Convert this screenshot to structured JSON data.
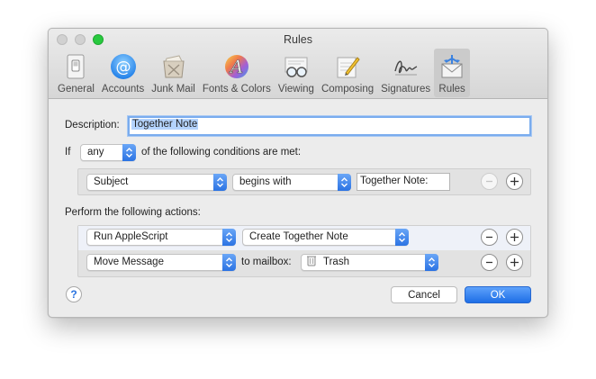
{
  "window": {
    "title": "Rules"
  },
  "toolbar": {
    "items": [
      {
        "label": "General",
        "icon": "general-switch-icon"
      },
      {
        "label": "Accounts",
        "icon": "at-sign-icon"
      },
      {
        "label": "Junk Mail",
        "icon": "junk-mail-bin-icon"
      },
      {
        "label": "Fonts & Colors",
        "icon": "fonts-colors-icon"
      },
      {
        "label": "Viewing",
        "icon": "glasses-icon"
      },
      {
        "label": "Composing",
        "icon": "pencil-paper-icon"
      },
      {
        "label": "Signatures",
        "icon": "signature-icon"
      },
      {
        "label": "Rules",
        "icon": "rules-envelope-icon",
        "selected": true
      }
    ]
  },
  "rule": {
    "description_label": "Description:",
    "description_value": "Together Note",
    "if_label": "If",
    "match_value": "any",
    "conditions_suffix": "of the following conditions are met:",
    "conditions": [
      {
        "field": "Subject",
        "operator": "begins with",
        "value": "Together Note:"
      }
    ],
    "actions_label": "Perform the following actions:",
    "actions": [
      {
        "action": "Run AppleScript",
        "target": "Create Together Note"
      },
      {
        "action": "Move Message",
        "connector": "to mailbox:",
        "target": "Trash",
        "target_icon": "trash-can-icon"
      }
    ]
  },
  "buttons": {
    "help": "?",
    "cancel": "Cancel",
    "ok": "OK",
    "remove": "−",
    "add": "+"
  },
  "colors": {
    "accent": "#2b73e3",
    "zoom_button": "#28c93f"
  }
}
